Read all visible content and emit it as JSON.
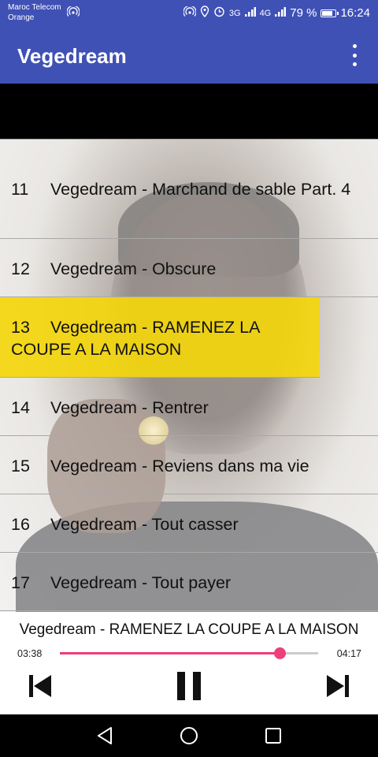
{
  "status_bar": {
    "carrier_1": "Maroc Telecom",
    "carrier_2": "Orange",
    "network_3g": "3G",
    "network_4g": "4G",
    "battery": "79 %",
    "time": "16:24"
  },
  "app_bar": {
    "title": "Vegedream"
  },
  "tracks": [
    {
      "num": "11",
      "title": "Vegedream - Marchand de sable Part. 4"
    },
    {
      "num": "12",
      "title": "Vegedream - Obscure"
    },
    {
      "num": "13",
      "title": "Vegedream - RAMENEZ LA COUPE A LA MAISON",
      "selected": true
    },
    {
      "num": "14",
      "title": "Vegedream - Rentrer"
    },
    {
      "num": "15",
      "title": "Vegedream - Reviens dans ma vie"
    },
    {
      "num": "16",
      "title": "Vegedream - Tout casser"
    },
    {
      "num": "17",
      "title": "Vegedream - Tout payer"
    }
  ],
  "player": {
    "now_playing": "Vegedream - RAMENEZ LA COUPE A LA MAISON",
    "current_time": "03:38",
    "total_time": "04:17",
    "progress": 0.85,
    "accent_color": "#EC407A",
    "icons": [
      "skip-previous-icon",
      "pause-icon",
      "skip-next-icon"
    ]
  },
  "nav_bar": {
    "icons": [
      "back-icon",
      "home-icon",
      "recents-icon"
    ]
  },
  "colors": {
    "primary": "#3F51B5",
    "highlight": "#F3D60C"
  }
}
